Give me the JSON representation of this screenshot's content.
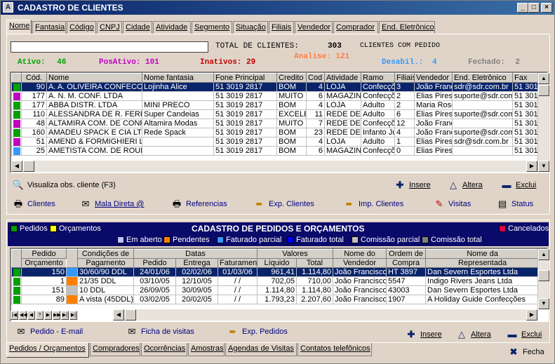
{
  "window": {
    "title": "CADASTRO DE CLIENTES"
  },
  "top_tabs": [
    "Nome",
    "Fantasia",
    "Código",
    "CNPJ",
    "Cidade",
    "Atividade",
    "Segmento",
    "Situação",
    "Filiais",
    "Vendedor",
    "Comprador",
    "End. Eletrônico"
  ],
  "stats": {
    "total_label": "TOTAL DE CLIENTES:",
    "total_value": "303",
    "com_pedido": "CLIENTES COM PEDIDO",
    "ativo_label": "Ativo:",
    "ativo_value": "46",
    "posativo_label": "PosAtivo:",
    "posativo_value": "101",
    "inativos_label": "Inativos:",
    "inativos_value": "29",
    "analise_label": "Analise:",
    "analise_value": "121",
    "desabil_label": "Desabil.:",
    "desabil_value": "4",
    "fechado_label": "Fechado:",
    "fechado_value": "2"
  },
  "clients": {
    "headers": [
      "Cód.",
      "Nome",
      "Nome fantasia",
      "Fone Principal",
      "Credito",
      "Cod",
      "Atividade",
      "Ramo",
      "Filiais",
      "Vendedor",
      "End. Eletrônico",
      "Fax"
    ],
    "rows": [
      {
        "color": "#00a000",
        "cod": "90",
        "nome": "A. A. OLIVEIRA CONFECCO",
        "fantasia": "Lojinha Alice",
        "fone": "51 3019 2817",
        "credito": "BOM",
        "c": "4",
        "atividade": "LOJA",
        "ramo": "Confecçõ",
        "filiais": "3",
        "vendedor": "João Francis",
        "email": "sdr@sdr.com.br",
        "fax": "51 3019",
        "sel": true
      },
      {
        "color": "#c000c0",
        "cod": "177",
        "nome": "A. N. M. CONF. LTDA",
        "fantasia": "",
        "fone": "51 3019 2817",
        "credito": "MUITO B",
        "c": "6",
        "atividade": "MAGAZINI",
        "ramo": "Confecçõ",
        "filiais": "2",
        "vendedor": "Elias Pires",
        "email": "suporte@sdr.com.br",
        "fax": "51 3019",
        "sel": false
      },
      {
        "color": "#00a000",
        "cod": "177",
        "nome": "ABBA DISTR. LTDA",
        "fantasia": "MINI PRECO",
        "fone": "51 3019 2817",
        "credito": "BOM",
        "c": "4",
        "atividade": "LOJA",
        "ramo": "Adulto",
        "filiais": "2",
        "vendedor": "Maria Rosé",
        "email": "",
        "fax": "51 3019",
        "sel": false
      },
      {
        "color": "#00a000",
        "cod": "110",
        "nome": "ALESSANDRA DE R. FERR",
        "fantasia": "Super Candeias",
        "fone": "51 3019 2817",
        "credito": "EXCELE",
        "c": "11",
        "atividade": "REDE DE",
        "ramo": "Adulto",
        "filiais": "6",
        "vendedor": "Elias Pires",
        "email": "suporte@sdr.com.br",
        "fax": "51 3019",
        "sel": false
      },
      {
        "color": "#c000c0",
        "cod": "48",
        "nome": "ALTAMIRA COM. DE CONF",
        "fantasia": "Altamira Modas",
        "fone": "51 3019 2817",
        "credito": "MUITO E",
        "c": "7",
        "atividade": "REDE DE",
        "ramo": "Confecçõ",
        "filiais": "12",
        "vendedor": "João Francis",
        "email": "",
        "fax": "51 3019",
        "sel": false
      },
      {
        "color": "#00a000",
        "cod": "160",
        "nome": "AMADEU SPACK E CIA LTD",
        "fantasia": "Rede Spack",
        "fone": "51 3019 2817",
        "credito": "BOM",
        "c": "23",
        "atividade": "REDE DE",
        "ramo": "Infanto Ju",
        "filiais": "4",
        "vendedor": "João Francis",
        "email": "suporte@sdr.com.br",
        "fax": "51 3019",
        "sel": false
      },
      {
        "color": "#c000c0",
        "cod": "51",
        "nome": "AMEND & FORMIGHIERI LT",
        "fantasia": "",
        "fone": "51 3019 2817",
        "credito": "BOM",
        "c": "4",
        "atividade": "LOJA",
        "ramo": "Adulto",
        "filiais": "1",
        "vendedor": "Elias Pires",
        "email": "sdr@sdr.com.br",
        "fax": "51 3019",
        "sel": false
      },
      {
        "color": "#3399ff",
        "cod": "25",
        "nome": "AMETISTA COM. DE ROUP",
        "fantasia": "",
        "fone": "51 3019 2817",
        "credito": "BOM",
        "c": "6",
        "atividade": "MAGAZINI",
        "ramo": "Confecçõ",
        "filiais": "0",
        "vendedor": "Elias Pires",
        "email": "",
        "fax": "51 3019",
        "sel": false
      }
    ]
  },
  "actions_top": {
    "visualiza": "Visualiza obs. cliente (F3)",
    "insere": "Insere",
    "altera": "Altera",
    "exclui": "Exclui",
    "clientes": "Clientes",
    "mala_direta": "Mala Direta @",
    "referencias": "Referencias",
    "exp_clientes": "Exp. Clientes",
    "imp_clientes": "Imp. Clientes",
    "visitas": "Visitas",
    "status": "Status"
  },
  "orders_header": {
    "pedidos": "Pedidos",
    "orcamentos": "Orçamentos",
    "title": "CADASTRO DE PEDIDOS E ORÇAMENTOS",
    "cancelados": "Cancelados",
    "em_aberto": "Em aberto",
    "pendentes": "Pendentes",
    "fat_parcial": "Faturado parcial",
    "fat_total": "Faturado total",
    "com_parcial": "Comissão parcial",
    "com_total": "Comissão total"
  },
  "orders": {
    "h1": [
      "Pedido",
      "Condições de",
      "Datas",
      "Valores",
      "Nome do",
      "Ordem de",
      "Nome da"
    ],
    "h2": [
      "Orçamento",
      "Pagamento",
      "Pedido",
      "Entrega",
      "Faturamen",
      "Líquido",
      "Total",
      "Vendedor",
      "Compra",
      "Representada"
    ],
    "rows": [
      {
        "color": "#00a000",
        "st": "#3399ff",
        "pedido": "150",
        "cond": "30/60/90 DDL",
        "dped": "24/01/06",
        "dent": "02/02/06",
        "dfat": "01/03/06",
        "liq": "961,41",
        "tot": "1.114,80",
        "vend": "João Francisco",
        "oc": "HT 3897",
        "rep": "Dan Severn Esportes Ltda",
        "sel": true
      },
      {
        "color": "#00a000",
        "st": "#ff8000",
        "pedido": "1",
        "cond": "21/35 DDL",
        "dped": "03/10/05",
        "dent": "12/10/05",
        "dfat": "/ /",
        "liq": "702,05",
        "tot": "710,00",
        "vend": "João Francisco",
        "oc": "5547",
        "rep": "Indigo Rivers Jeans Ltda",
        "sel": false
      },
      {
        "color": "#00a000",
        "st": "#c0c0c0",
        "pedido": "151",
        "cond": "10 DDL",
        "dped": "26/09/05",
        "dent": "30/09/05",
        "dfat": "/ /",
        "liq": "1.114,80",
        "tot": "1.114,80",
        "vend": "João Francisco",
        "oc": "43003",
        "rep": "Dan Severn Esportes Ltda",
        "sel": false
      },
      {
        "color": "#00a000",
        "st": "#ff8000",
        "pedido": "89",
        "cond": "A vista (45DDL)",
        "dped": "03/02/05",
        "dent": "20/02/05",
        "dfat": "/ /",
        "liq": "1.793,23",
        "tot": "2.207,60",
        "vend": "João Francisco",
        "oc": "1907",
        "rep": "A Holiday Guide Confecções",
        "sel": false
      }
    ]
  },
  "actions_bottom": {
    "pedido_email": "Pedido - E-mail",
    "ficha": "Ficha de visitas",
    "exp_pedidos": "Exp. Pedidos",
    "insere": "Insere",
    "altera": "Altera",
    "exclui": "Exclui"
  },
  "bottom_tabs": [
    "Pedidos / Orçamentos",
    "Compradores",
    "Ocorrências",
    "Amostras",
    "Agendas de Visitas",
    "Contatos telefônicos"
  ],
  "fecha": "Fecha",
  "colors": {
    "title": "#0a246a",
    "selection": "#0a246a",
    "ativo": "#00a000",
    "posativo": "#c000c0",
    "inativos": "#c00000",
    "analise": "#ff8040",
    "desabil": "#3399ff",
    "fechado": "#808080"
  }
}
